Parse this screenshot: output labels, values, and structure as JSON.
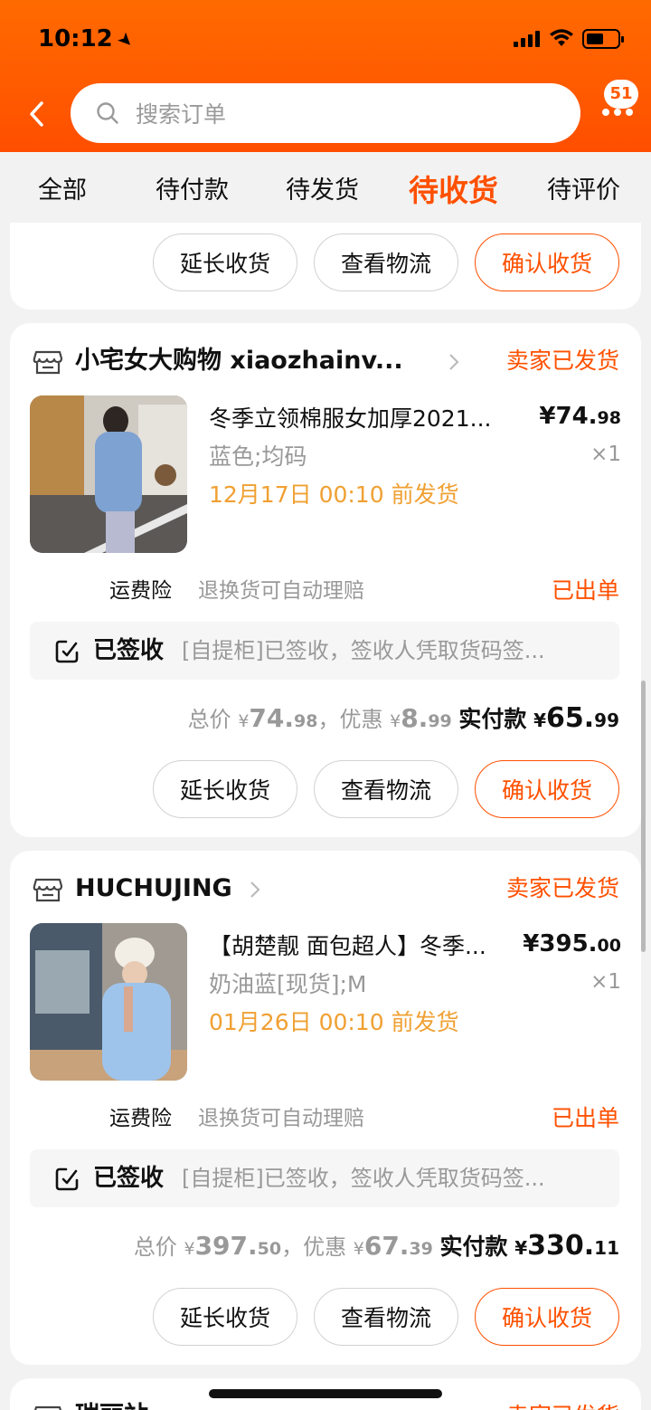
{
  "status_bar": {
    "time": "10:12"
  },
  "header": {
    "search_placeholder": "搜索订单",
    "badge_count": "51"
  },
  "tabs": [
    {
      "label": "全部",
      "active": false
    },
    {
      "label": "待付款",
      "active": false
    },
    {
      "label": "待发货",
      "active": false
    },
    {
      "label": "待收货",
      "active": true
    },
    {
      "label": "待评价",
      "active": false
    }
  ],
  "actions": {
    "extend": "延长收货",
    "logistics": "查看物流",
    "confirm": "确认收货"
  },
  "orders": [
    {
      "shop_name": "小宅女大购物 xiaozhainv...",
      "status": "卖家已发货",
      "item_title": "冬季立领棉服女加厚2021...",
      "price_int": "¥74.",
      "price_dec": "98",
      "spec": "蓝色;均码",
      "qty": "×1",
      "ship_note": "12月17日 00:10 前发货",
      "insurance_label": "运费险",
      "insurance_desc": "退换货可自动理赔",
      "insurance_status": "已出单",
      "logistics_state": "已签收",
      "logistics_detail": "[自提柜]已签收，签收人凭取货码签...",
      "total_label": "总价",
      "total_int": "74.",
      "total_dec": "98",
      "discount_label": "，优惠",
      "discount_int": "8.",
      "discount_dec": "99",
      "pay_label": "实付款",
      "pay_int": "65.",
      "pay_dec": "99"
    },
    {
      "shop_name": "HUCHUJING",
      "status": "卖家已发货",
      "item_title": "【胡楚靓 面包超人】冬季...",
      "price_int": "¥395.",
      "price_dec": "00",
      "spec": "奶油蓝[现货];M",
      "qty": "×1",
      "ship_note": "01月26日 00:10 前发货",
      "insurance_label": "运费险",
      "insurance_desc": "退换货可自动理赔",
      "insurance_status": "已出单",
      "logistics_state": "已签收",
      "logistics_detail": "[自提柜]已签收，签收人凭取货码签...",
      "total_label": "总价",
      "total_int": "397.",
      "total_dec": "50",
      "discount_label": "，优惠",
      "discount_int": "67.",
      "discount_dec": "39",
      "pay_label": "实付款",
      "pay_int": "330.",
      "pay_dec": "11"
    },
    {
      "shop_name": "瑞丽站",
      "status": "卖家已发货"
    }
  ],
  "yen": "¥",
  "colors": {
    "brand": "#ff5000",
    "ship_note": "#f0a032",
    "muted": "#999999"
  }
}
